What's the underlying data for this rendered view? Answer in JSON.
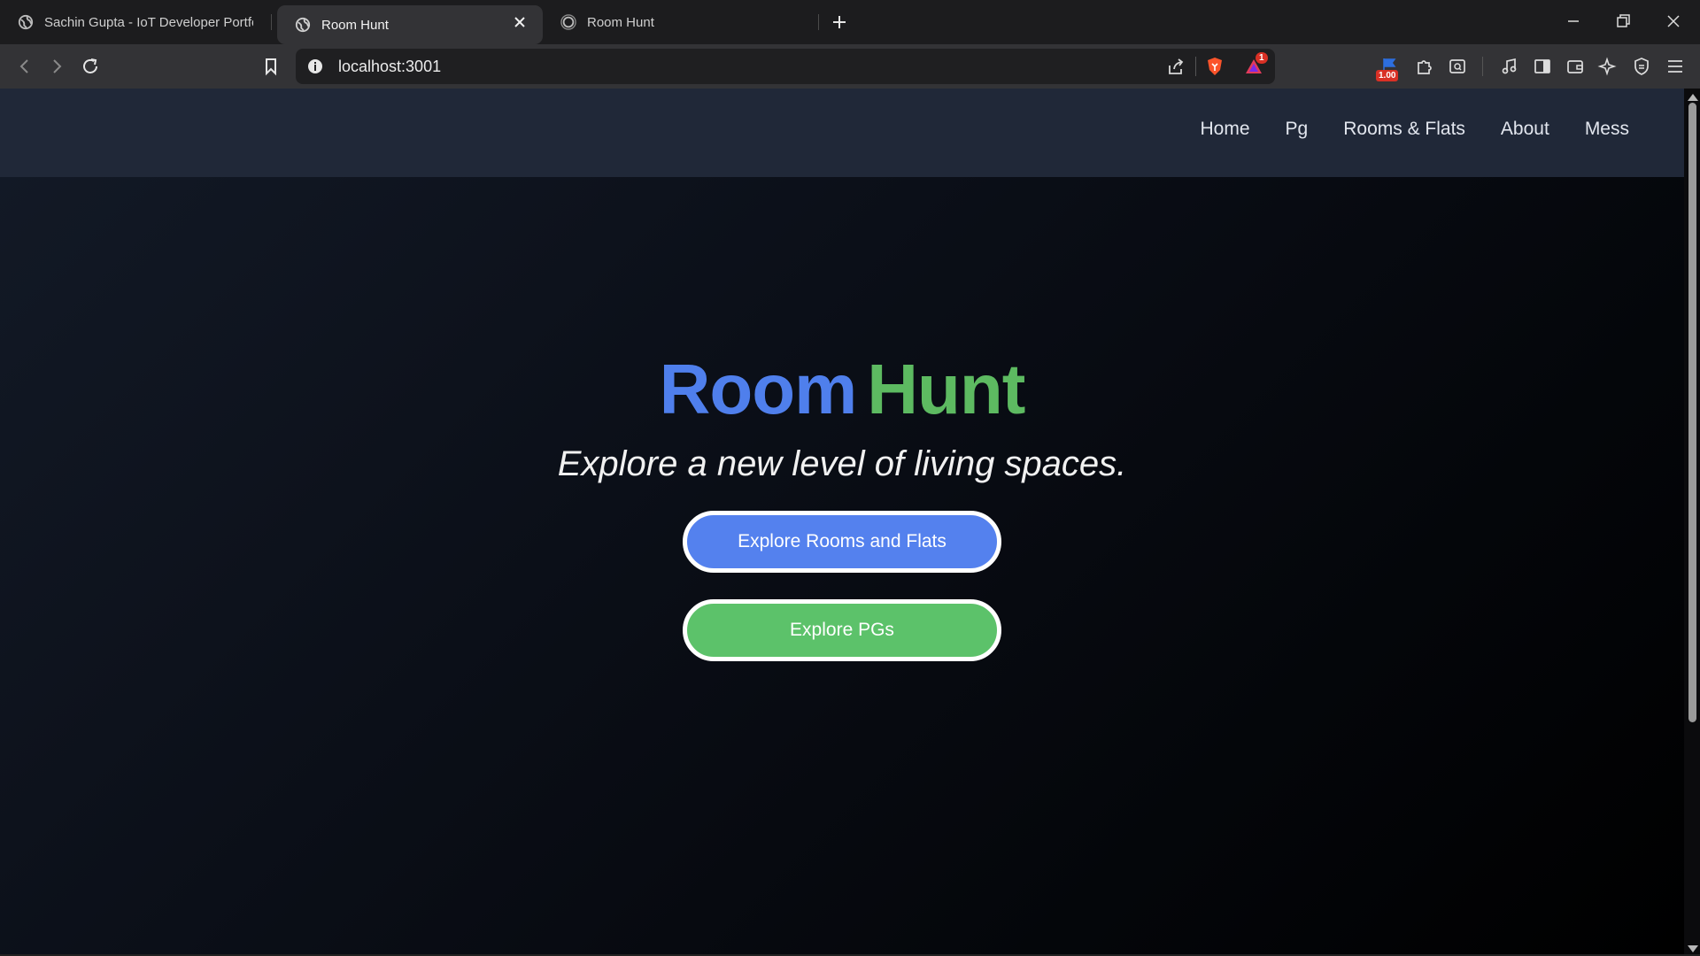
{
  "browser": {
    "tabs": [
      {
        "title": "Sachin Gupta - IoT Developer Portfoli",
        "active": false,
        "icon": "globe-icon"
      },
      {
        "title": "Room Hunt",
        "active": true,
        "icon": "globe-icon"
      },
      {
        "title": "Room Hunt",
        "active": false,
        "icon": "loading-globe-icon"
      }
    ],
    "url": "localhost:3001",
    "rewards_badge": "1",
    "notification_badge": "1.00"
  },
  "site": {
    "nav": {
      "links": [
        "Home",
        "Pg",
        "Rooms & Flats",
        "About",
        "Mess"
      ]
    },
    "hero": {
      "brand_part1": "Room",
      "brand_part2": "Hunt",
      "tagline": "Explore a new level of living spaces.",
      "primary_button": "Explore Rooms and Flats",
      "secondary_button": "Explore PGs"
    }
  },
  "colors": {
    "brand_blue": "#4f7fec",
    "brand_green": "#5dba61",
    "nav_bg": "#202838"
  }
}
